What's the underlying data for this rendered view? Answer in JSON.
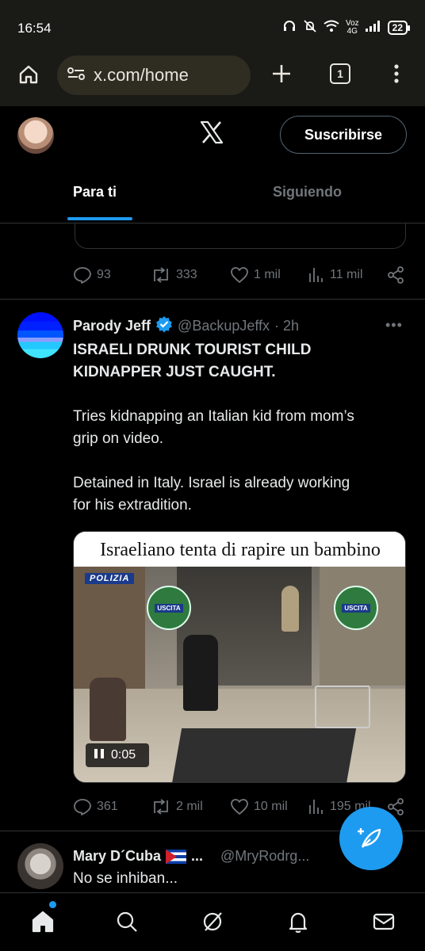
{
  "status_bar": {
    "time": "16:54",
    "network_label_top": "Voz",
    "network_label_bottom": "4G",
    "battery": "22"
  },
  "browser": {
    "url": "x.com/home",
    "tab_count": "1"
  },
  "header": {
    "subscribe_label": "Suscribirse"
  },
  "tabs": [
    {
      "label": "Para ti",
      "active": true
    },
    {
      "label": "Siguiendo",
      "active": false
    }
  ],
  "prev_tweet_actions": {
    "replies": "93",
    "reposts": "333",
    "likes": "1 mil",
    "views": "11 mil"
  },
  "tweet": {
    "name": "Parody Jeff",
    "handle": "@BackupJeffx",
    "time": "· 2h",
    "headline_line1": "ISRAELI DRUNK TOURIST CHILD",
    "headline_line2": "KIDNAPPER JUST CAUGHT.",
    "para2_line1": "Tries kidnapping an Italian kid from mom’s",
    "para2_line2": "grip on video.",
    "para3_line1": "Detained in Italy. Israel is already working",
    "para3_line2": "for his extradition.",
    "media_title": "Israeliano tenta di rapire un bambino",
    "media_sign_police": "POLIZIA",
    "media_sign_exit": "USCITA",
    "video_duration": "0:05",
    "actions": {
      "replies": "361",
      "reposts": "2 mil",
      "likes": "10 mil",
      "views": "195 mil"
    }
  },
  "tweet2": {
    "name": "Mary D´Cuba",
    "ellipsis": "...",
    "handle": "@MryRodrg...",
    "text": "No se inhiban..."
  },
  "colors": {
    "accent": "#1d9bf0",
    "background": "#000000",
    "muted": "#71767b",
    "text": "#e7e9ea"
  }
}
